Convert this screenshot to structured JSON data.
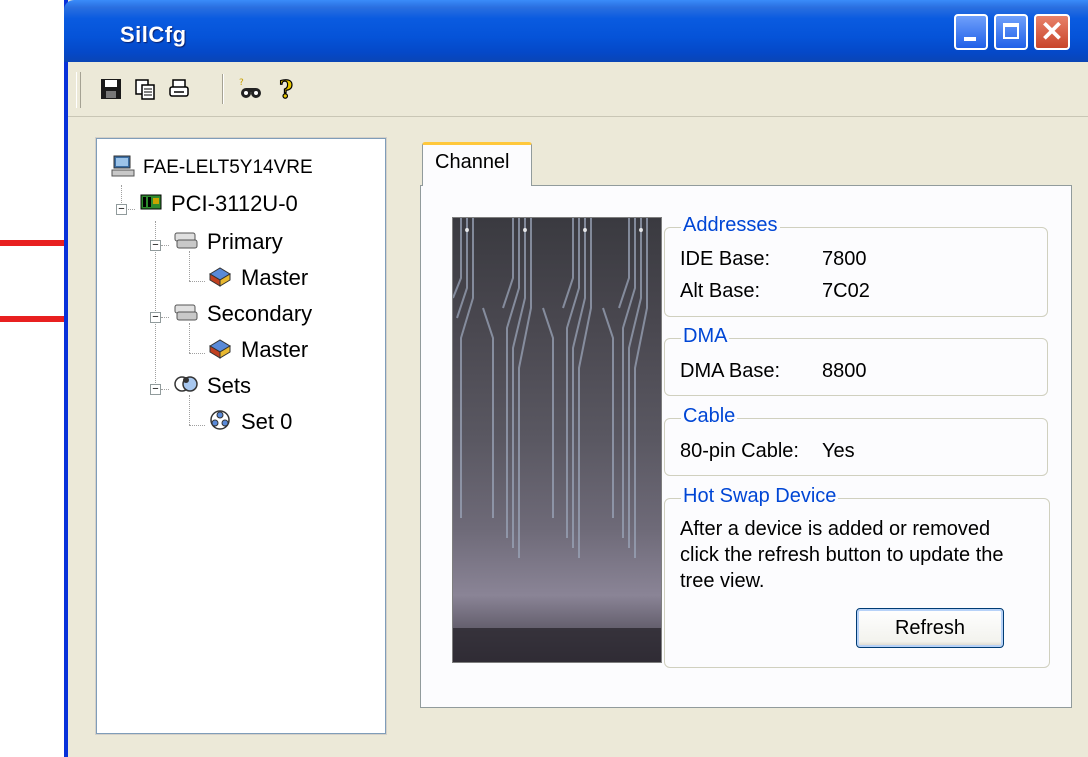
{
  "window": {
    "title": "SilCfg"
  },
  "toolbar": {
    "icons": [
      "save-icon",
      "copy-icon",
      "print-icon",
      "find-icon",
      "help-icon"
    ]
  },
  "tree": {
    "root": "FAE-LELT5Y14VRE",
    "controller": "PCI-3112U-0",
    "primary": "Primary",
    "primary_child": "Master",
    "secondary": "Secondary",
    "secondary_child": "Master",
    "sets": "Sets",
    "set0": "Set 0",
    "expander_symbol": "−"
  },
  "tab": {
    "label": "Channel"
  },
  "addresses": {
    "title": "Addresses",
    "ide_label": "IDE Base:",
    "ide_value": "7800",
    "alt_label": "Alt Base:",
    "alt_value": "7C02"
  },
  "dma": {
    "title": "DMA",
    "label": "DMA Base:",
    "value": "8800"
  },
  "cable": {
    "title": "Cable",
    "label": "80-pin Cable:",
    "value": "Yes"
  },
  "hotswap": {
    "title": "Hot Swap Device",
    "line1": "After a device is added or removed",
    "line2": "click the refresh button to update the",
    "line3": "tree view.",
    "button": "Refresh"
  },
  "colors": {
    "titlebar": "#0553D8",
    "groupbox_title": "#0046D5",
    "annotation_arrow": "#E82020",
    "tab_highlight": "#FFC83C"
  }
}
